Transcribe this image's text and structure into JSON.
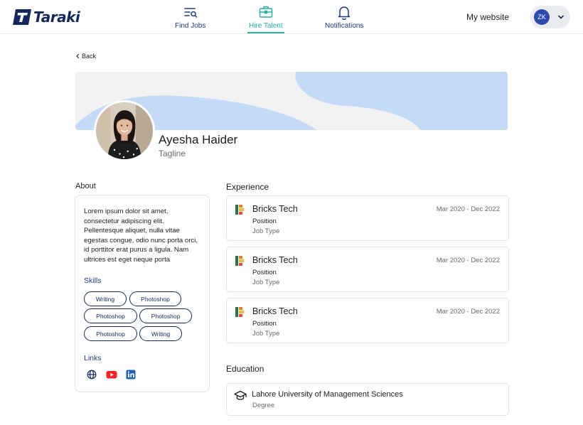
{
  "brand": {
    "name": "Taraki",
    "color": "#13285f"
  },
  "nav": {
    "items": [
      {
        "label": "Find Jobs",
        "icon": "job-list-search-icon",
        "active": false
      },
      {
        "label": "Hire Talent",
        "icon": "briefcase-icon",
        "active": true
      },
      {
        "label": "Notifications",
        "icon": "bell-icon",
        "active": false
      }
    ],
    "my_website": "My website",
    "user_initials": "ZK",
    "active_color": "#1fb3a3"
  },
  "back_label": "Back",
  "profile": {
    "name": "Ayesha Haider",
    "tagline": "Tagline"
  },
  "about": {
    "title": "About",
    "text": "Lorem ipsum dolor sit amet, consectetur adipiscing elit. Pellentesque aliquet, nulla vitae egestas congue, odio nunc porta orci, id porttitor erat purus a ligula. Nam ultrices est eget neque porta",
    "skills_title": "Skills",
    "skills": [
      "Writing",
      "Photoshop",
      "Photoshop",
      "Photoshop",
      "Photoshop",
      "Writing"
    ],
    "links_title": "Links",
    "links": [
      "globe-icon",
      "youtube-icon",
      "linkedin-icon"
    ]
  },
  "experience": {
    "title": "Experience",
    "items": [
      {
        "company": "Bricks Tech",
        "dates": "Mar 2020 - Dec 2022",
        "position": "Position",
        "job_type": "Job Type"
      },
      {
        "company": "Bricks Tech",
        "dates": "Mar 2020 - Dec 2022",
        "position": "Position",
        "job_type": "Job Type"
      },
      {
        "company": "Bricks Tech",
        "dates": "Mar 2020 - Dec 2022",
        "position": "Position",
        "job_type": "Job Type"
      }
    ]
  },
  "education": {
    "title": "Education",
    "items": [
      {
        "school": "Lahore University of Management Sciences",
        "degree": "Degree"
      }
    ]
  }
}
